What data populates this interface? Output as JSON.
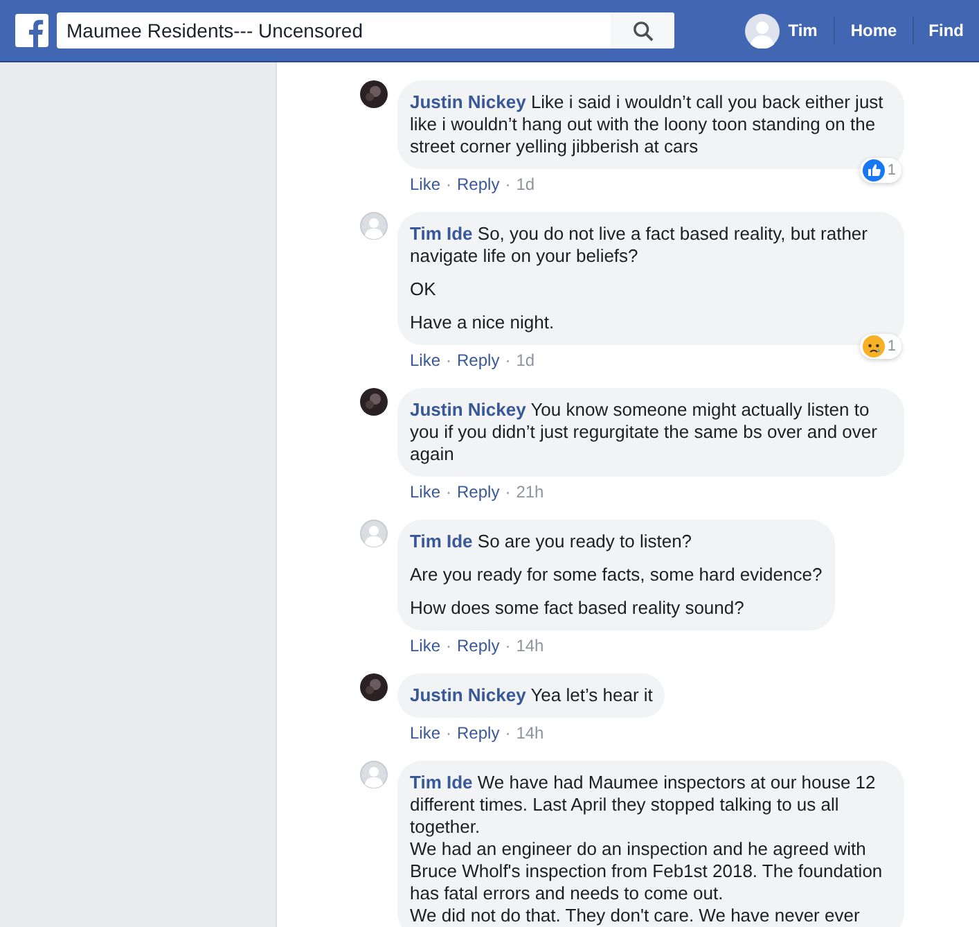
{
  "separator": "·",
  "top_bar": {
    "search": {
      "value": "Maumee Residents--- Uncensored"
    },
    "user": "Tim",
    "nav": [
      "Home",
      "Find"
    ]
  },
  "comments": [
    {
      "author": "Justin Nickey",
      "avatar": {
        "kind": "photo"
      },
      "paragraphs": [
        "Like i said i wouldn’t call you back either just like i wouldn’t hang out with the loony toon standing on the street corner yelling jibberish at cars"
      ],
      "actions": [
        "Like",
        "Reply"
      ],
      "time": "1d",
      "reaction": {
        "kind": "like",
        "count": "1"
      }
    },
    {
      "author": "Tim Ide",
      "avatar": {
        "kind": "default"
      },
      "paragraphs": [
        "So, you do not live a fact based reality, but rather navigate life on your beliefs?",
        "OK",
        "Have a nice night."
      ],
      "actions": [
        "Like",
        "Reply"
      ],
      "time": "1d",
      "reaction": {
        "kind": "sad",
        "count": "1"
      }
    },
    {
      "author": "Justin Nickey",
      "avatar": {
        "kind": "photo"
      },
      "paragraphs": [
        "You know someone might actually listen to you if you didn’t just regurgitate the same bs over and over again"
      ],
      "actions": [
        "Like",
        "Reply"
      ],
      "time": "21h"
    },
    {
      "author": "Tim Ide",
      "avatar": {
        "kind": "default"
      },
      "paragraphs": [
        "So are you ready to listen?",
        "Are you ready for some facts, some hard evidence?",
        "How does some fact based reality sound?"
      ],
      "actions": [
        "Like",
        "Reply"
      ],
      "time": "14h"
    },
    {
      "author": "Justin Nickey",
      "avatar": {
        "kind": "photo"
      },
      "paragraphs": [
        "Yea let’s hear it"
      ],
      "actions": [
        "Like",
        "Reply"
      ],
      "time": "14h"
    },
    {
      "author": "Tim Ide",
      "avatar": {
        "kind": "default"
      },
      "paragraphs": [
        "We have had Maumee inspectors at our house 12 different times. Last April they stopped talking to us all together.\nWe had an engineer do an inspection and he agreed with Bruce Wholf's inspection from Feb1st 2018. The foundation has fatal errors and needs to come out.\nWe did not do that. They don't care. We have never ever"
      ]
    }
  ]
}
